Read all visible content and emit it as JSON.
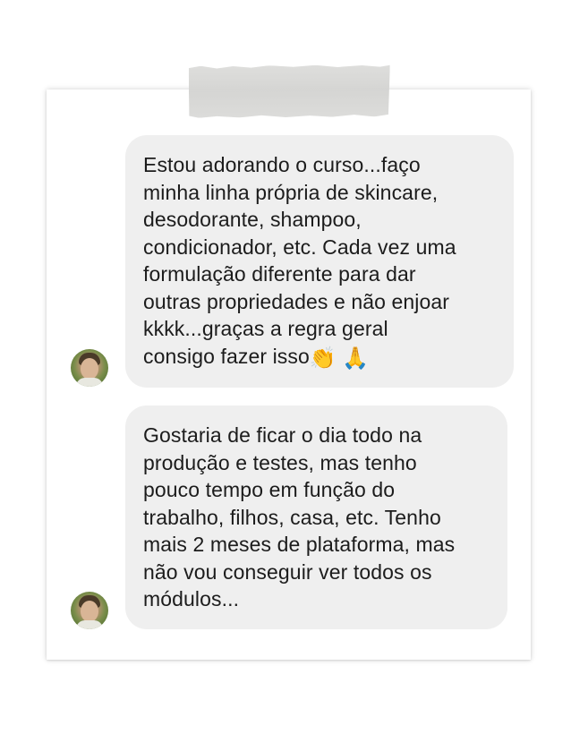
{
  "messages": [
    {
      "lines": [
        "Estou adorando o curso...faço",
        "minha linha própria de skincare,",
        "desodorante, shampoo,",
        "condicionador, etc. Cada vez uma",
        "formulação diferente para dar",
        "outras propriedades e não enjoar",
        "kkkk...graças a regra geral",
        "consigo fazer isso"
      ],
      "emojis": [
        "👏",
        "🙏"
      ]
    },
    {
      "lines": [
        "Gostaria de ficar o dia todo na",
        "produção e testes, mas tenho",
        "pouco tempo em função do",
        "trabalho, filhos, casa, etc. Tenho",
        "mais 2 meses de plataforma, mas",
        "não vou conseguir ver todos os",
        "módulos..."
      ]
    }
  ],
  "colors": {
    "bubble": "#efefef",
    "text": "#1c1c1c",
    "card": "#ffffff",
    "tape": "#d6d6d4"
  }
}
